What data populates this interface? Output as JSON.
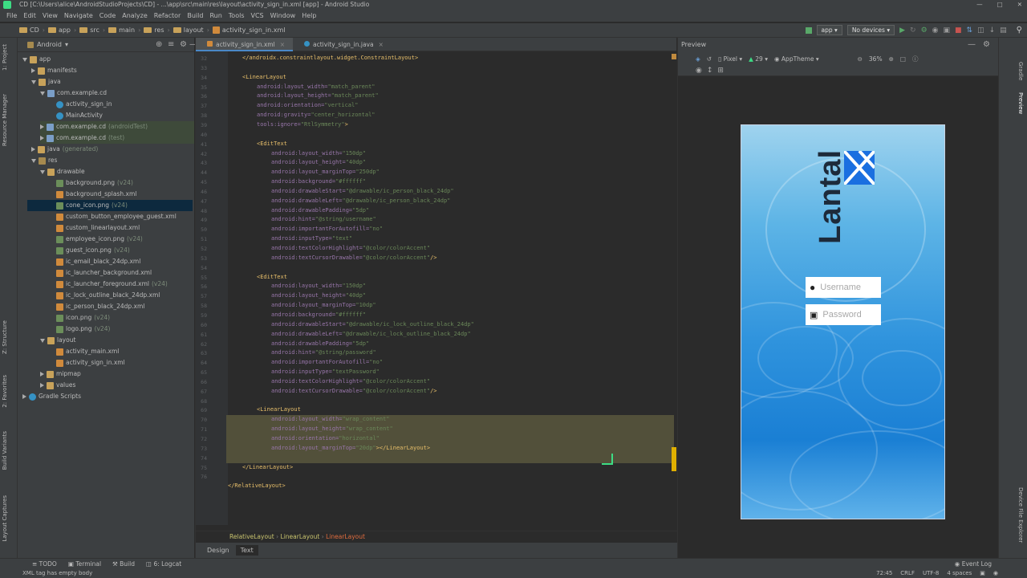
{
  "window": {
    "title": "CD [C:\\Users\\alice\\AndroidStudioProjects\\CD] - ...\\app\\src\\main\\res\\layout\\activity_sign_in.xml [app] - Android Studio"
  },
  "menu": [
    "File",
    "Edit",
    "View",
    "Navigate",
    "Code",
    "Analyze",
    "Refactor",
    "Build",
    "Run",
    "Tools",
    "VCS",
    "Window",
    "Help"
  ],
  "breadcrumb": [
    "CD",
    "app",
    "src",
    "main",
    "res",
    "layout",
    "activity_sign_in.xml"
  ],
  "toolbar": {
    "run_config": "app",
    "device": "No devices"
  },
  "left_tabs": [
    "1: Project",
    "Resource Manager",
    "Z: Structure",
    "2: Favorites",
    "Build Variants",
    "Layout Captures"
  ],
  "project": {
    "view": "Android",
    "tree": [
      {
        "label": "app",
        "sub": "",
        "kind": "folder",
        "depth": 0,
        "open": true
      },
      {
        "label": "manifests",
        "sub": "",
        "kind": "folder",
        "depth": 1,
        "open": false
      },
      {
        "label": "java",
        "sub": "",
        "kind": "folder",
        "depth": 1,
        "open": true
      },
      {
        "label": "com.example.cd",
        "sub": "",
        "kind": "pkg",
        "depth": 2,
        "open": true
      },
      {
        "label": "activity_sign_in",
        "sub": "",
        "kind": "cls",
        "depth": 3
      },
      {
        "label": "MainActivity",
        "sub": "",
        "kind": "cls",
        "depth": 3
      },
      {
        "label": "com.example.cd",
        "sub": "(androidTest)",
        "kind": "pkg",
        "depth": 2,
        "open": false
      },
      {
        "label": "com.example.cd",
        "sub": "(test)",
        "kind": "pkg",
        "depth": 2,
        "open": false
      },
      {
        "label": "java",
        "sub": "(generated)",
        "kind": "folder",
        "depth": 1,
        "open": false
      },
      {
        "label": "res",
        "sub": "",
        "kind": "res",
        "depth": 1,
        "open": true
      },
      {
        "label": "drawable",
        "sub": "",
        "kind": "folder",
        "depth": 2,
        "open": true
      },
      {
        "label": "background.png",
        "sub": "(v24)",
        "kind": "img",
        "depth": 3
      },
      {
        "label": "background_splash.xml",
        "sub": "",
        "kind": "xml",
        "depth": 3
      },
      {
        "label": "cone_icon.png",
        "sub": "(v24)",
        "kind": "img",
        "depth": 3,
        "selected": true
      },
      {
        "label": "custom_button_employee_guest.xml",
        "sub": "",
        "kind": "xml",
        "depth": 3
      },
      {
        "label": "custom_linearlayout.xml",
        "sub": "",
        "kind": "xml",
        "depth": 3
      },
      {
        "label": "employee_icon.png",
        "sub": "(v24)",
        "kind": "img",
        "depth": 3
      },
      {
        "label": "guest_icon.png",
        "sub": "(v24)",
        "kind": "img",
        "depth": 3
      },
      {
        "label": "ic_email_black_24dp.xml",
        "sub": "",
        "kind": "xml",
        "depth": 3
      },
      {
        "label": "ic_launcher_background.xml",
        "sub": "",
        "kind": "xml",
        "depth": 3
      },
      {
        "label": "ic_launcher_foreground.xml",
        "sub": "(v24)",
        "kind": "xml",
        "depth": 3
      },
      {
        "label": "ic_lock_outline_black_24dp.xml",
        "sub": "",
        "kind": "xml",
        "depth": 3
      },
      {
        "label": "ic_person_black_24dp.xml",
        "sub": "",
        "kind": "xml",
        "depth": 3
      },
      {
        "label": "icon.png",
        "sub": "(v24)",
        "kind": "img",
        "depth": 3
      },
      {
        "label": "logo.png",
        "sub": "(v24)",
        "kind": "img",
        "depth": 3
      },
      {
        "label": "layout",
        "sub": "",
        "kind": "folder",
        "depth": 2,
        "open": true
      },
      {
        "label": "activity_main.xml",
        "sub": "",
        "kind": "xml",
        "depth": 3
      },
      {
        "label": "activity_sign_in.xml",
        "sub": "",
        "kind": "xml",
        "depth": 3
      },
      {
        "label": "mipmap",
        "sub": "",
        "kind": "folder",
        "depth": 2,
        "open": false
      },
      {
        "label": "values",
        "sub": "",
        "kind": "folder",
        "depth": 2,
        "open": false
      },
      {
        "label": "Gradle Scripts",
        "sub": "",
        "kind": "gradle",
        "depth": 0,
        "open": false
      }
    ]
  },
  "editor": {
    "tabs": [
      {
        "label": "activity_sign_in.xml",
        "active": true
      },
      {
        "label": "activity_sign_in.java",
        "active": false
      }
    ],
    "line_numbers": [
      "32",
      "33",
      "34",
      "35",
      "36",
      "37",
      "38",
      "39",
      "40",
      "41",
      "42",
      "43",
      "44",
      "45",
      "46",
      "47",
      "48",
      "49",
      "50",
      "51",
      "52",
      "53",
      "54",
      "55",
      "56",
      "57",
      "58",
      "59",
      "60",
      "61",
      "62",
      "63",
      "64",
      "65",
      "66",
      "67",
      "68",
      "69",
      "70",
      "71",
      "72",
      "73",
      "74",
      "75",
      "76"
    ],
    "lines": [
      {
        "i": 0,
        "t": "</androidx.constraintlayout.widget.ConstraintLayout>"
      },
      {
        "i": 0,
        "t": ""
      },
      {
        "i": 0,
        "t": "<LinearLayout"
      },
      {
        "i": 1,
        "t": "android:layout_width=\"match_parent\""
      },
      {
        "i": 1,
        "t": "android:layout_height=\"match_parent\""
      },
      {
        "i": 1,
        "t": "android:orientation=\"vertical\""
      },
      {
        "i": 1,
        "t": "android:gravity=\"center_horizontal\""
      },
      {
        "i": 1,
        "t": "tools:ignore=\"RtlSymmetry\">"
      },
      {
        "i": 0,
        "t": ""
      },
      {
        "i": 1,
        "t": "<EditText"
      },
      {
        "i": 2,
        "t": "android:layout_width=\"150dp\""
      },
      {
        "i": 2,
        "t": "android:layout_height=\"40dp\""
      },
      {
        "i": 2,
        "t": "android:layout_marginTop=\"250dp\""
      },
      {
        "i": 2,
        "t": "android:background=\"#ffffff\""
      },
      {
        "i": 2,
        "t": "android:drawableStart=\"@drawable/ic_person_black_24dp\""
      },
      {
        "i": 2,
        "t": "android:drawableLeft=\"@drawable/ic_person_black_24dp\""
      },
      {
        "i": 2,
        "t": "android:drawablePadding=\"5dp\""
      },
      {
        "i": 2,
        "t": "android:hint=\"@string/username\""
      },
      {
        "i": 2,
        "t": "android:importantForAutofill=\"no\""
      },
      {
        "i": 2,
        "t": "android:inputType=\"text\""
      },
      {
        "i": 2,
        "t": "android:textColorHighlight=\"@color/colorAccent\""
      },
      {
        "i": 2,
        "t": "android:textCursorDrawable=\"@color/colorAccent\"/>"
      },
      {
        "i": 0,
        "t": ""
      },
      {
        "i": 1,
        "t": "<EditText"
      },
      {
        "i": 2,
        "t": "android:layout_width=\"150dp\""
      },
      {
        "i": 2,
        "t": "android:layout_height=\"40dp\""
      },
      {
        "i": 2,
        "t": "android:layout_marginTop=\"10dp\""
      },
      {
        "i": 2,
        "t": "android:background=\"#ffffff\""
      },
      {
        "i": 2,
        "t": "android:drawableStart=\"@drawable/ic_lock_outline_black_24dp\""
      },
      {
        "i": 2,
        "t": "android:drawableLeft=\"@drawable/ic_lock_outline_black_24dp\""
      },
      {
        "i": 2,
        "t": "android:drawablePadding=\"5dp\""
      },
      {
        "i": 2,
        "t": "android:hint=\"@string/password\""
      },
      {
        "i": 2,
        "t": "android:importantForAutofill=\"no\""
      },
      {
        "i": 2,
        "t": "android:inputType=\"textPassword\""
      },
      {
        "i": 2,
        "t": "android:textColorHighlight=\"@color/colorAccent\""
      },
      {
        "i": 2,
        "t": "android:textCursorDrawable=\"@color/colorAccent\"/>"
      },
      {
        "i": 0,
        "t": ""
      },
      {
        "i": 1,
        "t": "<LinearLayout"
      },
      {
        "i": 2,
        "t": "android:layout_width=\"wrap_content\""
      },
      {
        "i": 2,
        "t": "android:layout_height=\"wrap_content\""
      },
      {
        "i": 2,
        "t": "android:orientation=\"horizontal\""
      },
      {
        "i": 2,
        "t": "android:layout_marginTop=\"20dp\"></LinearLayout>"
      },
      {
        "i": 0,
        "t": ""
      },
      {
        "i": 0,
        "t": "</LinearLayout>"
      },
      {
        "i": -1,
        "t": ""
      },
      {
        "i": -1,
        "t": "</RelativeLayout>"
      }
    ],
    "breadcrumbs": [
      "RelativeLayout",
      "LinearLayout",
      "LinearLayout"
    ],
    "mode_tabs": [
      "Design",
      "Text"
    ],
    "active_mode": "Text"
  },
  "preview": {
    "title": "Preview",
    "device": "Pixel",
    "api": "29",
    "theme": "AppTheme",
    "zoom": "36%",
    "logo_text": "Lantal",
    "username_hint": "Username",
    "password_hint": "Password"
  },
  "right_tabs": [
    "Gradle",
    "Preview",
    "Device File Explorer"
  ],
  "bottom_tools": [
    "TODO",
    "Terminal",
    "Build",
    "6: Logcat"
  ],
  "event_log": "Event Log",
  "status": {
    "message": "XML tag has empty body",
    "position": "72:45",
    "line_sep": "CRLF",
    "encoding": "UTF-8",
    "indent": "4 spaces"
  },
  "colors": {
    "accent": "#4a88c7",
    "highlight": "#52503a",
    "tag": "#e8bf6a",
    "attr_value": "#6a8759",
    "brand_blue": "#1a6fe0"
  }
}
